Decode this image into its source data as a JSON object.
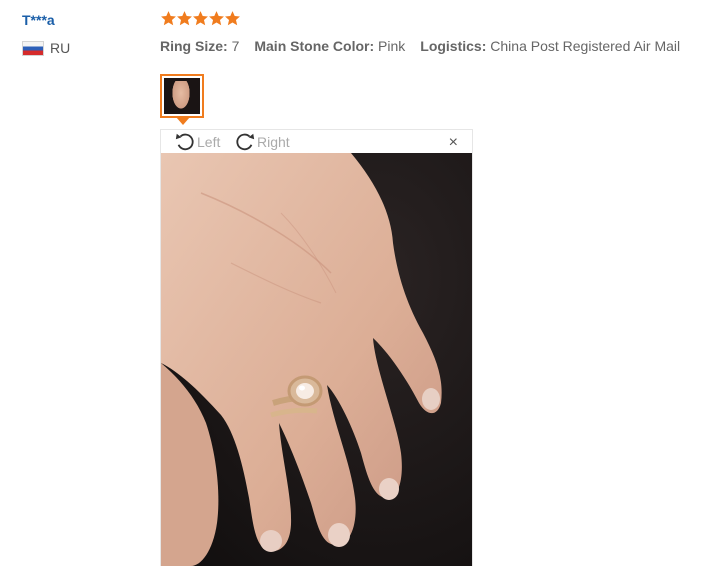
{
  "reviewer": {
    "name": "T***a",
    "country_code": "RU",
    "flag_icon": "russia-flag-icon"
  },
  "rating": {
    "stars": 5,
    "max": 5,
    "icon": "star-icon",
    "color": "#f07c1e"
  },
  "attributes": [
    {
      "key": "Ring Size:",
      "value": "7"
    },
    {
      "key": "Main Stone Color:",
      "value": "Pink"
    },
    {
      "key": "Logistics:",
      "value": "China Post Registered Air Mail"
    }
  ],
  "viewer": {
    "rotate_left_label": "Left",
    "rotate_right_label": "Right",
    "close_label": "×"
  },
  "colors": {
    "accent": "#f07c1e",
    "link": "#1a5ea8"
  }
}
